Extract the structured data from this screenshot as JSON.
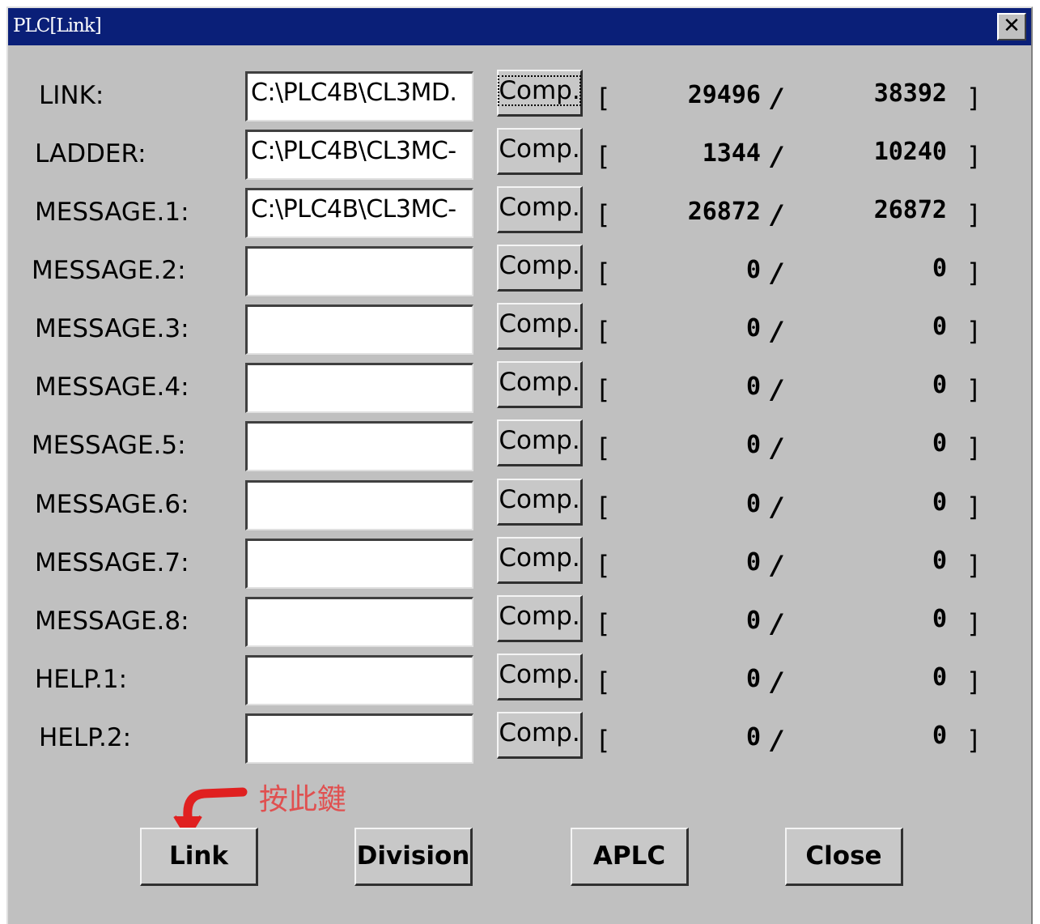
{
  "window": {
    "title": "PLC[Link]",
    "close_glyph": "✕"
  },
  "rows": [
    {
      "label": "LINK:",
      "path": "C:\\PLC4B\\CL3MD.",
      "button": "Comp.",
      "used": "29496",
      "total": "38392"
    },
    {
      "label": "LADDER:",
      "path": "C:\\PLC4B\\CL3MC-",
      "button": "Comp.",
      "used": "1344",
      "total": "10240"
    },
    {
      "label": "MESSAGE.1:",
      "path": "C:\\PLC4B\\CL3MC-",
      "button": "Comp.",
      "used": "26872",
      "total": "26872"
    },
    {
      "label": "MESSAGE.2:",
      "path": "",
      "button": "Comp.",
      "used": "0",
      "total": "0"
    },
    {
      "label": "MESSAGE.3:",
      "path": "",
      "button": "Comp.",
      "used": "0",
      "total": "0"
    },
    {
      "label": "MESSAGE.4:",
      "path": "",
      "button": "Comp.",
      "used": "0",
      "total": "0"
    },
    {
      "label": "MESSAGE.5:",
      "path": "",
      "button": "Comp.",
      "used": "0",
      "total": "0"
    },
    {
      "label": "MESSAGE.6:",
      "path": "",
      "button": "Comp.",
      "used": "0",
      "total": "0"
    },
    {
      "label": "MESSAGE.7:",
      "path": "",
      "button": "Comp.",
      "used": "0",
      "total": "0"
    },
    {
      "label": "MESSAGE.8:",
      "path": "",
      "button": "Comp.",
      "used": "0",
      "total": "0"
    },
    {
      "label": "HELP.1:",
      "path": "",
      "button": "Comp.",
      "used": "0",
      "total": "0"
    },
    {
      "label": "HELP.2:",
      "path": "",
      "button": "Comp.",
      "used": "0",
      "total": "0"
    }
  ],
  "symbols": {
    "open_bracket": "[",
    "close_bracket": "]",
    "slash": "/"
  },
  "buttons": {
    "link": "Link",
    "division": "Division",
    "aplc": "APLC",
    "close": "Close"
  },
  "annotation": {
    "text": "按此鍵",
    "color": "#e02020",
    "icon": "curved-arrow-icon"
  },
  "colors": {
    "titlebar": "#0a1f78",
    "dialog_bg": "#c0c0c0"
  }
}
